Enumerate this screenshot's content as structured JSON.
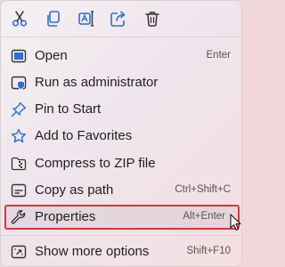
{
  "toolbar": {
    "buttons": [
      {
        "icon": "cut-icon"
      },
      {
        "icon": "copy-icon"
      },
      {
        "icon": "rename-icon"
      },
      {
        "icon": "share-icon"
      },
      {
        "icon": "delete-icon"
      }
    ]
  },
  "menu": {
    "items": [
      {
        "label": "Open",
        "shortcut": "Enter",
        "icon": "open-window-icon"
      },
      {
        "label": "Run as administrator",
        "shortcut": "",
        "icon": "shield-icon"
      },
      {
        "label": "Pin to Start",
        "shortcut": "",
        "icon": "pin-icon"
      },
      {
        "label": "Add to Favorites",
        "shortcut": "",
        "icon": "star-icon"
      },
      {
        "label": "Compress to ZIP file",
        "shortcut": "",
        "icon": "zip-folder-icon"
      },
      {
        "label": "Copy as path",
        "shortcut": "Ctrl+Shift+C",
        "icon": "copy-path-icon"
      },
      {
        "label": "Properties",
        "shortcut": "Alt+Enter",
        "icon": "wrench-icon"
      },
      {
        "label": "Show more options",
        "shortcut": "Shift+F10",
        "icon": "more-options-icon"
      }
    ]
  },
  "colors": {
    "accent": "#2a6fd6",
    "highlight_border": "#d9353a"
  }
}
